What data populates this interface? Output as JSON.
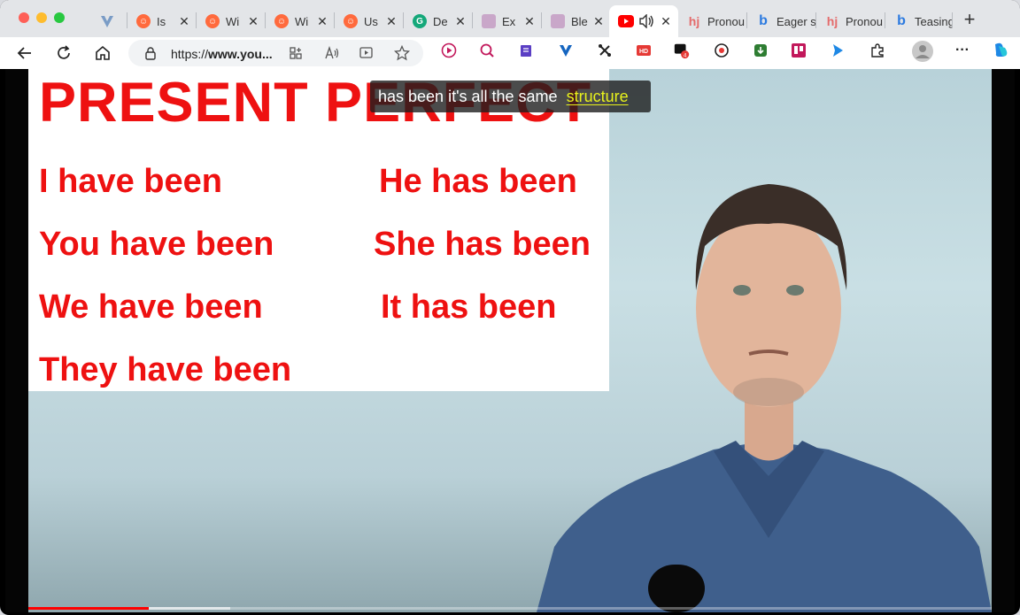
{
  "browser": {
    "tabs": [
      {
        "label": "",
        "icon": "vivaldi-v-icon",
        "color": "#7a9cc6",
        "close": ""
      },
      {
        "label": "Is",
        "icon": "reddit-icon",
        "color": "#ff6a3d",
        "close": "✕"
      },
      {
        "label": "Wi",
        "icon": "reddit-icon",
        "color": "#ff6a3d",
        "close": "✕"
      },
      {
        "label": "Wi",
        "icon": "reddit-icon",
        "color": "#ff6a3d",
        "close": "✕"
      },
      {
        "label": "Us",
        "icon": "reddit-icon",
        "color": "#ff6a3d",
        "close": "✕"
      },
      {
        "label": "De",
        "icon": "grammarly-icon",
        "color": "#15a87a",
        "close": "✕"
      },
      {
        "label": "Ex",
        "icon": "ex-icon",
        "color": "#c9a7c9",
        "close": "✕"
      },
      {
        "label": "Ble",
        "icon": "ble-icon",
        "color": "#c9a7c9",
        "close": "✕"
      },
      {
        "label": "",
        "icon": "youtube-icon",
        "color": "#ff0000",
        "close": "✕",
        "audio": "speaker-icon"
      },
      {
        "label": "Pronou",
        "icon": "hi-icon",
        "color": "#e46b6b",
        "close": ""
      },
      {
        "label": "Eager s",
        "icon": "bing-icon",
        "color": "#2b7ae0",
        "close": ""
      },
      {
        "label": "Pronou",
        "icon": "hi-icon",
        "color": "#e46b6b",
        "close": ""
      },
      {
        "label": "Teasing",
        "icon": "bing-icon",
        "color": "#2b7ae0",
        "close": ""
      }
    ],
    "new_tab": "+",
    "url": "https://www.you...",
    "url_parts": {
      "prefix": "https://",
      "domain": "www.you..."
    },
    "more_menu": "···"
  },
  "video": {
    "whiteboard_title": "PRESENT PERFECT",
    "phrases": {
      "i": "I have been",
      "you": "You have been",
      "we": "We have been",
      "they": "They have been",
      "he": "He has been",
      "she": "She has been",
      "it": "It has been"
    },
    "caption_text": "has been it's all the same",
    "caption_highlight": "structure",
    "progress": 0.125,
    "buffered": 0.21
  },
  "colors": {
    "accent_red": "#ee1111",
    "caption_highlight": "#e8f21c",
    "progress_red": "#ff0000"
  }
}
